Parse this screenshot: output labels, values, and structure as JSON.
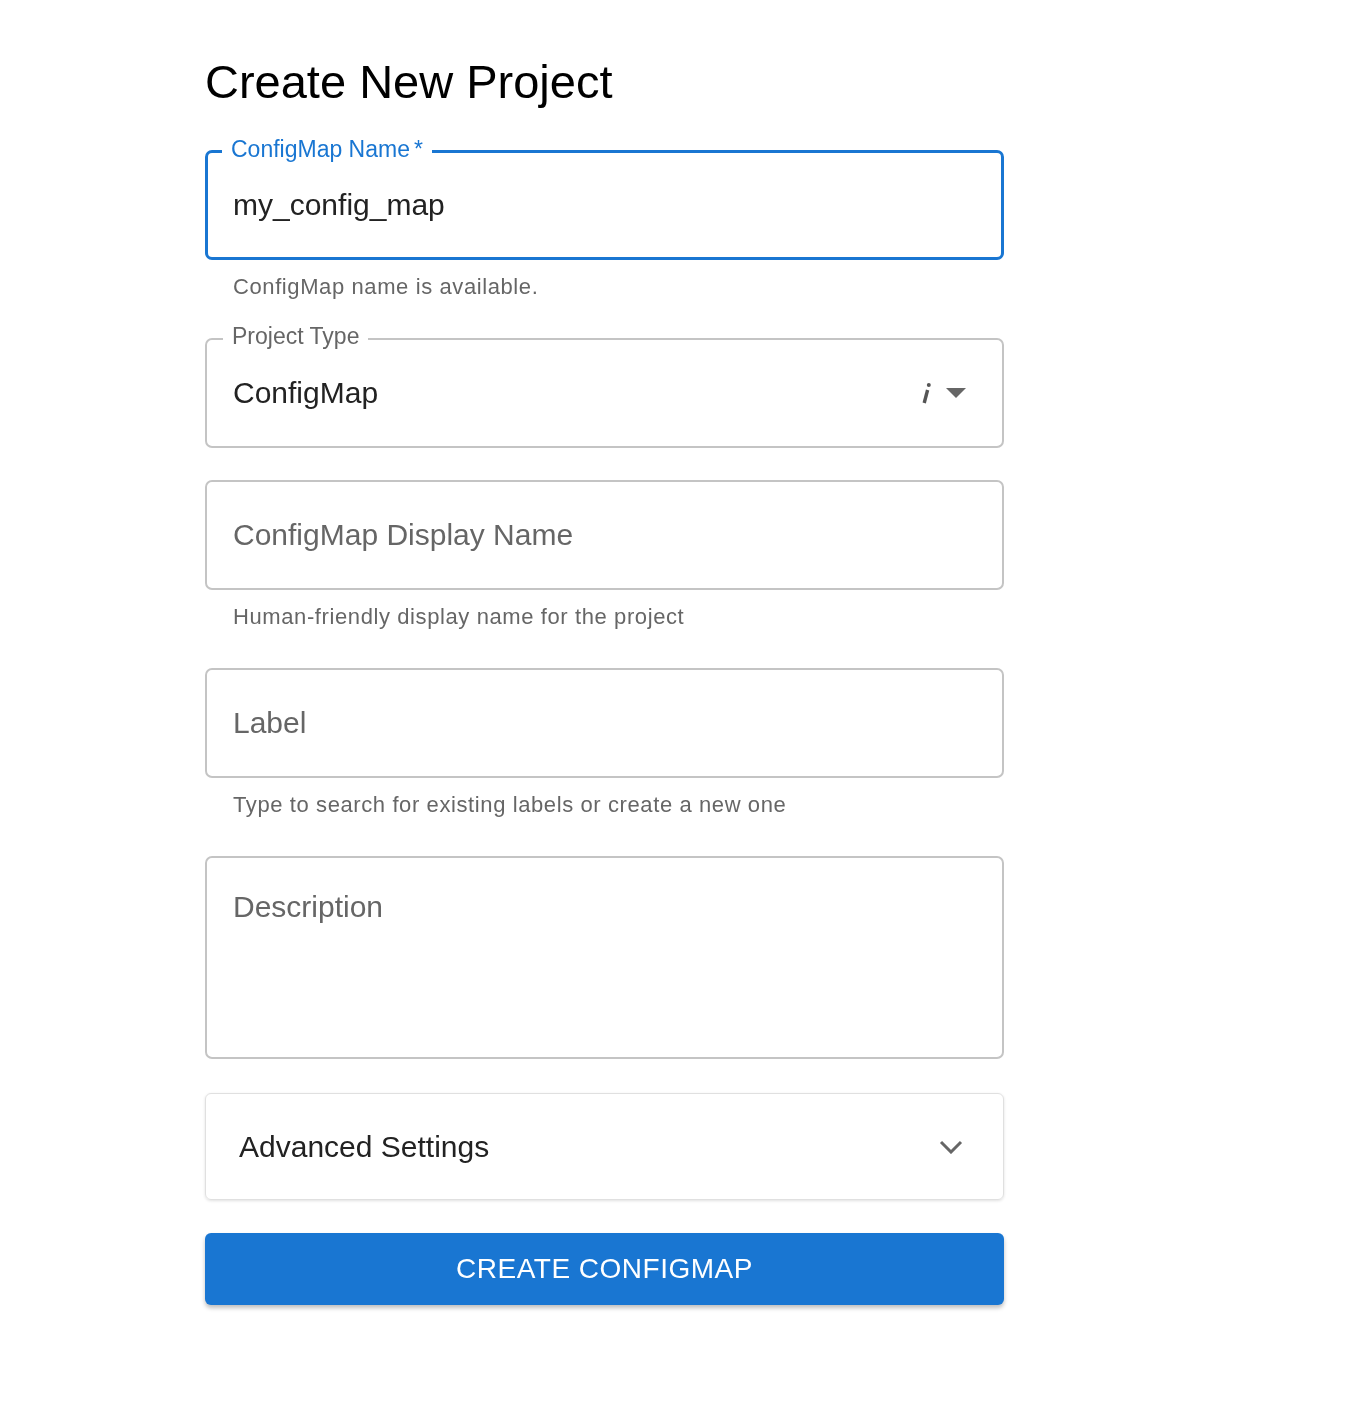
{
  "title": "Create New Project",
  "fields": [
    {
      "kind": "text",
      "label": "ConfigMap Name",
      "required_mark": "*",
      "focused": true,
      "value": "my_config_map",
      "helper": "ConfigMap name is available."
    },
    {
      "kind": "select",
      "label": "Project Type",
      "focused": false,
      "value": "ConfigMap"
    },
    {
      "kind": "text",
      "focused": false,
      "placeholder": "ConfigMap Display Name",
      "helper": "Human-friendly display name for the project"
    },
    {
      "kind": "text",
      "focused": false,
      "placeholder": "Label",
      "helper": "Type to search for existing labels or create a new one"
    },
    {
      "kind": "textarea",
      "focused": false,
      "placeholder": "Description"
    }
  ],
  "accordion": {
    "title": "Advanced Settings",
    "expanded": false
  },
  "submit": "CREATE CONFIGMAP"
}
